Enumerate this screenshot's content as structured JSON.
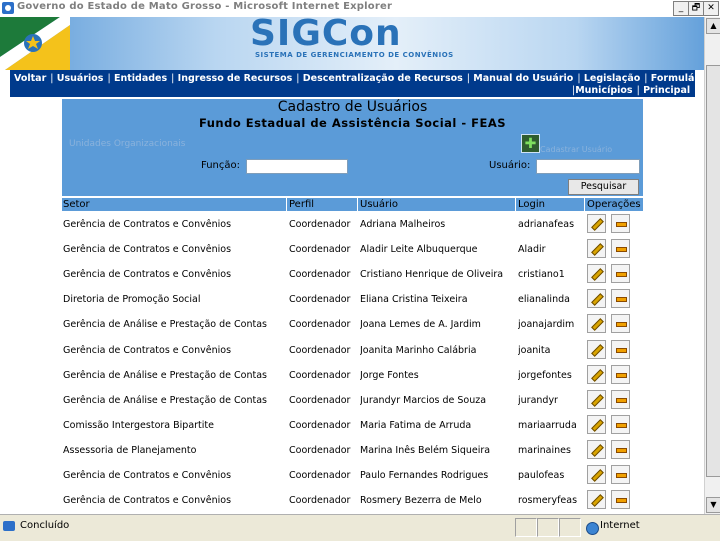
{
  "window": {
    "title": "Governo do Estado de Mato Grosso - Microsoft Internet Explorer",
    "controls": [
      "_",
      "🗗",
      "✕"
    ]
  },
  "banner": {
    "logo": "SIGCon",
    "subtitle": "SISTEMA DE GERENCIAMENTO DE CONVÊNIOS"
  },
  "nav": {
    "row1": [
      "Voltar",
      "Usuários",
      "Entidades",
      "Ingresso de Recursos",
      "Descentralização de Recursos",
      "Manual do Usuário",
      "Legislação",
      "Formulários"
    ],
    "row2": [
      "Municípios",
      "Principal"
    ]
  },
  "form": {
    "title": "Cadastro de Usuários",
    "subtitle": "Fundo Estadual de Assistência Social - FEAS",
    "units_label": "Unidades Organizacionais",
    "add_label": "Cadastrar Usuário",
    "funcao_label": "Função:",
    "usuario_label": "Usuário:",
    "funcao_value": "",
    "usuario_value": "",
    "search_button": "Pesquisar"
  },
  "table": {
    "headers": [
      "Setor",
      "Perfil",
      "Usuário",
      "Login",
      "Operações"
    ],
    "rows": [
      {
        "setor": "Gerência de Contratos e Convênios",
        "perfil": "Coordenador",
        "usuario": "Adriana Malheiros",
        "login": "adrianafeas"
      },
      {
        "setor": "Gerência de Contratos e Convênios",
        "perfil": "Coordenador",
        "usuario": "Aladir Leite Albuquerque",
        "login": "Aladir"
      },
      {
        "setor": "Gerência de Contratos e Convênios",
        "perfil": "Coordenador",
        "usuario": "Cristiano Henrique de Oliveira",
        "login": "cristiano1"
      },
      {
        "setor": "Diretoria de Promoção Social",
        "perfil": "Coordenador",
        "usuario": "Eliana Cristina Teixeira",
        "login": "elianalinda"
      },
      {
        "setor": "Gerência de Análise e Prestação de Contas",
        "perfil": "Coordenador",
        "usuario": "Joana Lemes de A. Jardim",
        "login": "joanajardim"
      },
      {
        "setor": "Gerência de Contratos e Convênios",
        "perfil": "Coordenador",
        "usuario": "Joanita Marinho Calábria",
        "login": "joanita"
      },
      {
        "setor": "Gerência de Análise e Prestação de Contas",
        "perfil": "Coordenador",
        "usuario": "Jorge Fontes",
        "login": "jorgefontes"
      },
      {
        "setor": "Gerência de Análise e Prestação de Contas",
        "perfil": "Coordenador",
        "usuario": "Jurandyr Marcios de Souza",
        "login": "jurandyr"
      },
      {
        "setor": "Comissão Intergestora Bipartite",
        "perfil": "Coordenador",
        "usuario": "Maria Fatima de Arruda",
        "login": "mariaarruda"
      },
      {
        "setor": "Assessoria de Planejamento",
        "perfil": "Coordenador",
        "usuario": "Marina Inês Belém Siqueira",
        "login": "marinaines"
      },
      {
        "setor": "Gerência de Contratos e Convênios",
        "perfil": "Coordenador",
        "usuario": "Paulo Fernandes Rodrigues",
        "login": "paulofeas"
      },
      {
        "setor": "Gerência de Contratos e Convênios",
        "perfil": "Coordenador",
        "usuario": "Rosmery Bezerra de Melo",
        "login": "rosmeryfeas"
      }
    ]
  },
  "status": {
    "left": "Concluído",
    "zone": "Internet"
  },
  "colors": {
    "nav_bg": "#003a8c",
    "panel_bg": "#5b9bd8",
    "logo": "#2a72b8"
  }
}
